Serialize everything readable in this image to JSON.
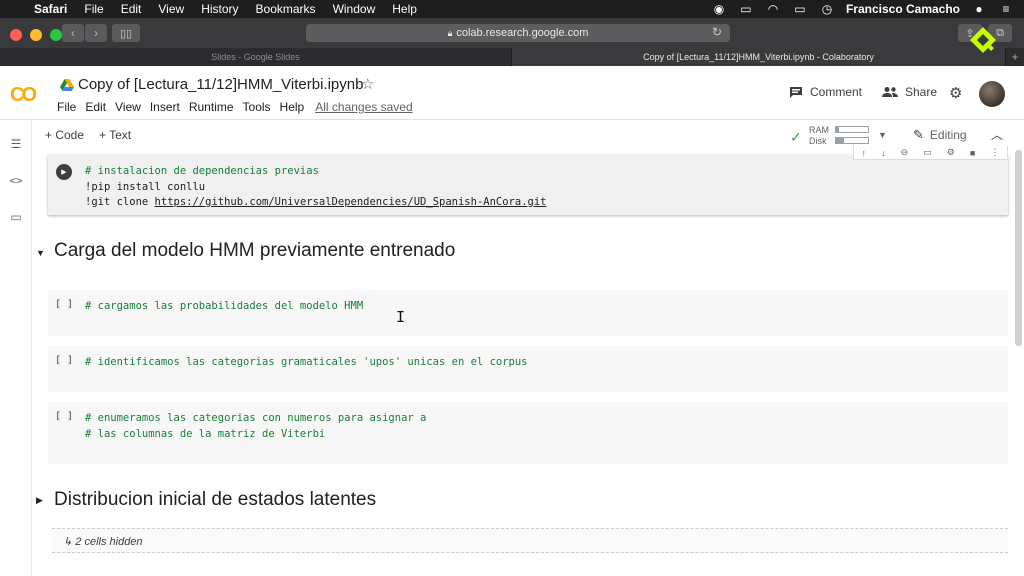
{
  "menubar": {
    "app": "Safari",
    "items": [
      "File",
      "Edit",
      "View",
      "History",
      "Bookmarks",
      "Window",
      "Help"
    ],
    "user": "Francisco Camacho",
    "icons": [
      "record-icon",
      "airplay-icon",
      "wifi-icon",
      "battery-icon",
      "clock-icon"
    ]
  },
  "browser": {
    "url": "colab.research.google.com",
    "tabs": [
      {
        "label": "Slides - Google Slides",
        "active": false
      },
      {
        "label": "Copy of [Lectura_11/12]HMM_Viterbi.ipynb - Colaboratory",
        "active": true
      }
    ]
  },
  "colab": {
    "logo": "CO",
    "title": "Copy of [Lectura_11/12]HMM_Viterbi.ipynb",
    "menu": [
      "File",
      "Edit",
      "View",
      "Insert",
      "Runtime",
      "Tools",
      "Help"
    ],
    "saved_status": "All changes saved",
    "comment_label": "Comment",
    "share_label": "Share"
  },
  "toolbar": {
    "add_code": "+ Code",
    "add_text": "+ Text",
    "ram_label": "RAM",
    "disk_label": "Disk",
    "ram_usage": 0.1,
    "disk_usage": 0.25,
    "editing_label": "Editing"
  },
  "cells": {
    "cell0": {
      "lines": [
        "# instalacion de dependencias previas",
        "!pip install conllu",
        "!git clone "
      ],
      "url": "https://github.com/UniversalDependencies/UD_Spanish-AnCora.git"
    },
    "heading1": "Carga del modelo HMM previamente entrenado",
    "cell1": {
      "bracket": "[ ]",
      "line1": "# cargamos las probabilidades del modelo HMM"
    },
    "cell2": {
      "bracket": "[ ]",
      "line1": "# identificamos las categorias gramaticales 'upos' unicas en el corpus"
    },
    "cell3": {
      "bracket": "[ ]",
      "line1": "# enumeramos las categorias con numeros para asignar a",
      "line2": "# las columnas de la matriz de Viterbi"
    },
    "heading2": "Distribucion inicial de estados latentes",
    "hidden_cells": "↳ 2 cells hidden"
  },
  "colors": {
    "comment_green": "#188038",
    "colab_orange": "#f9ab00",
    "colab_orange_dark": "#e37400",
    "menubar_bg": "#1e1e1e"
  }
}
